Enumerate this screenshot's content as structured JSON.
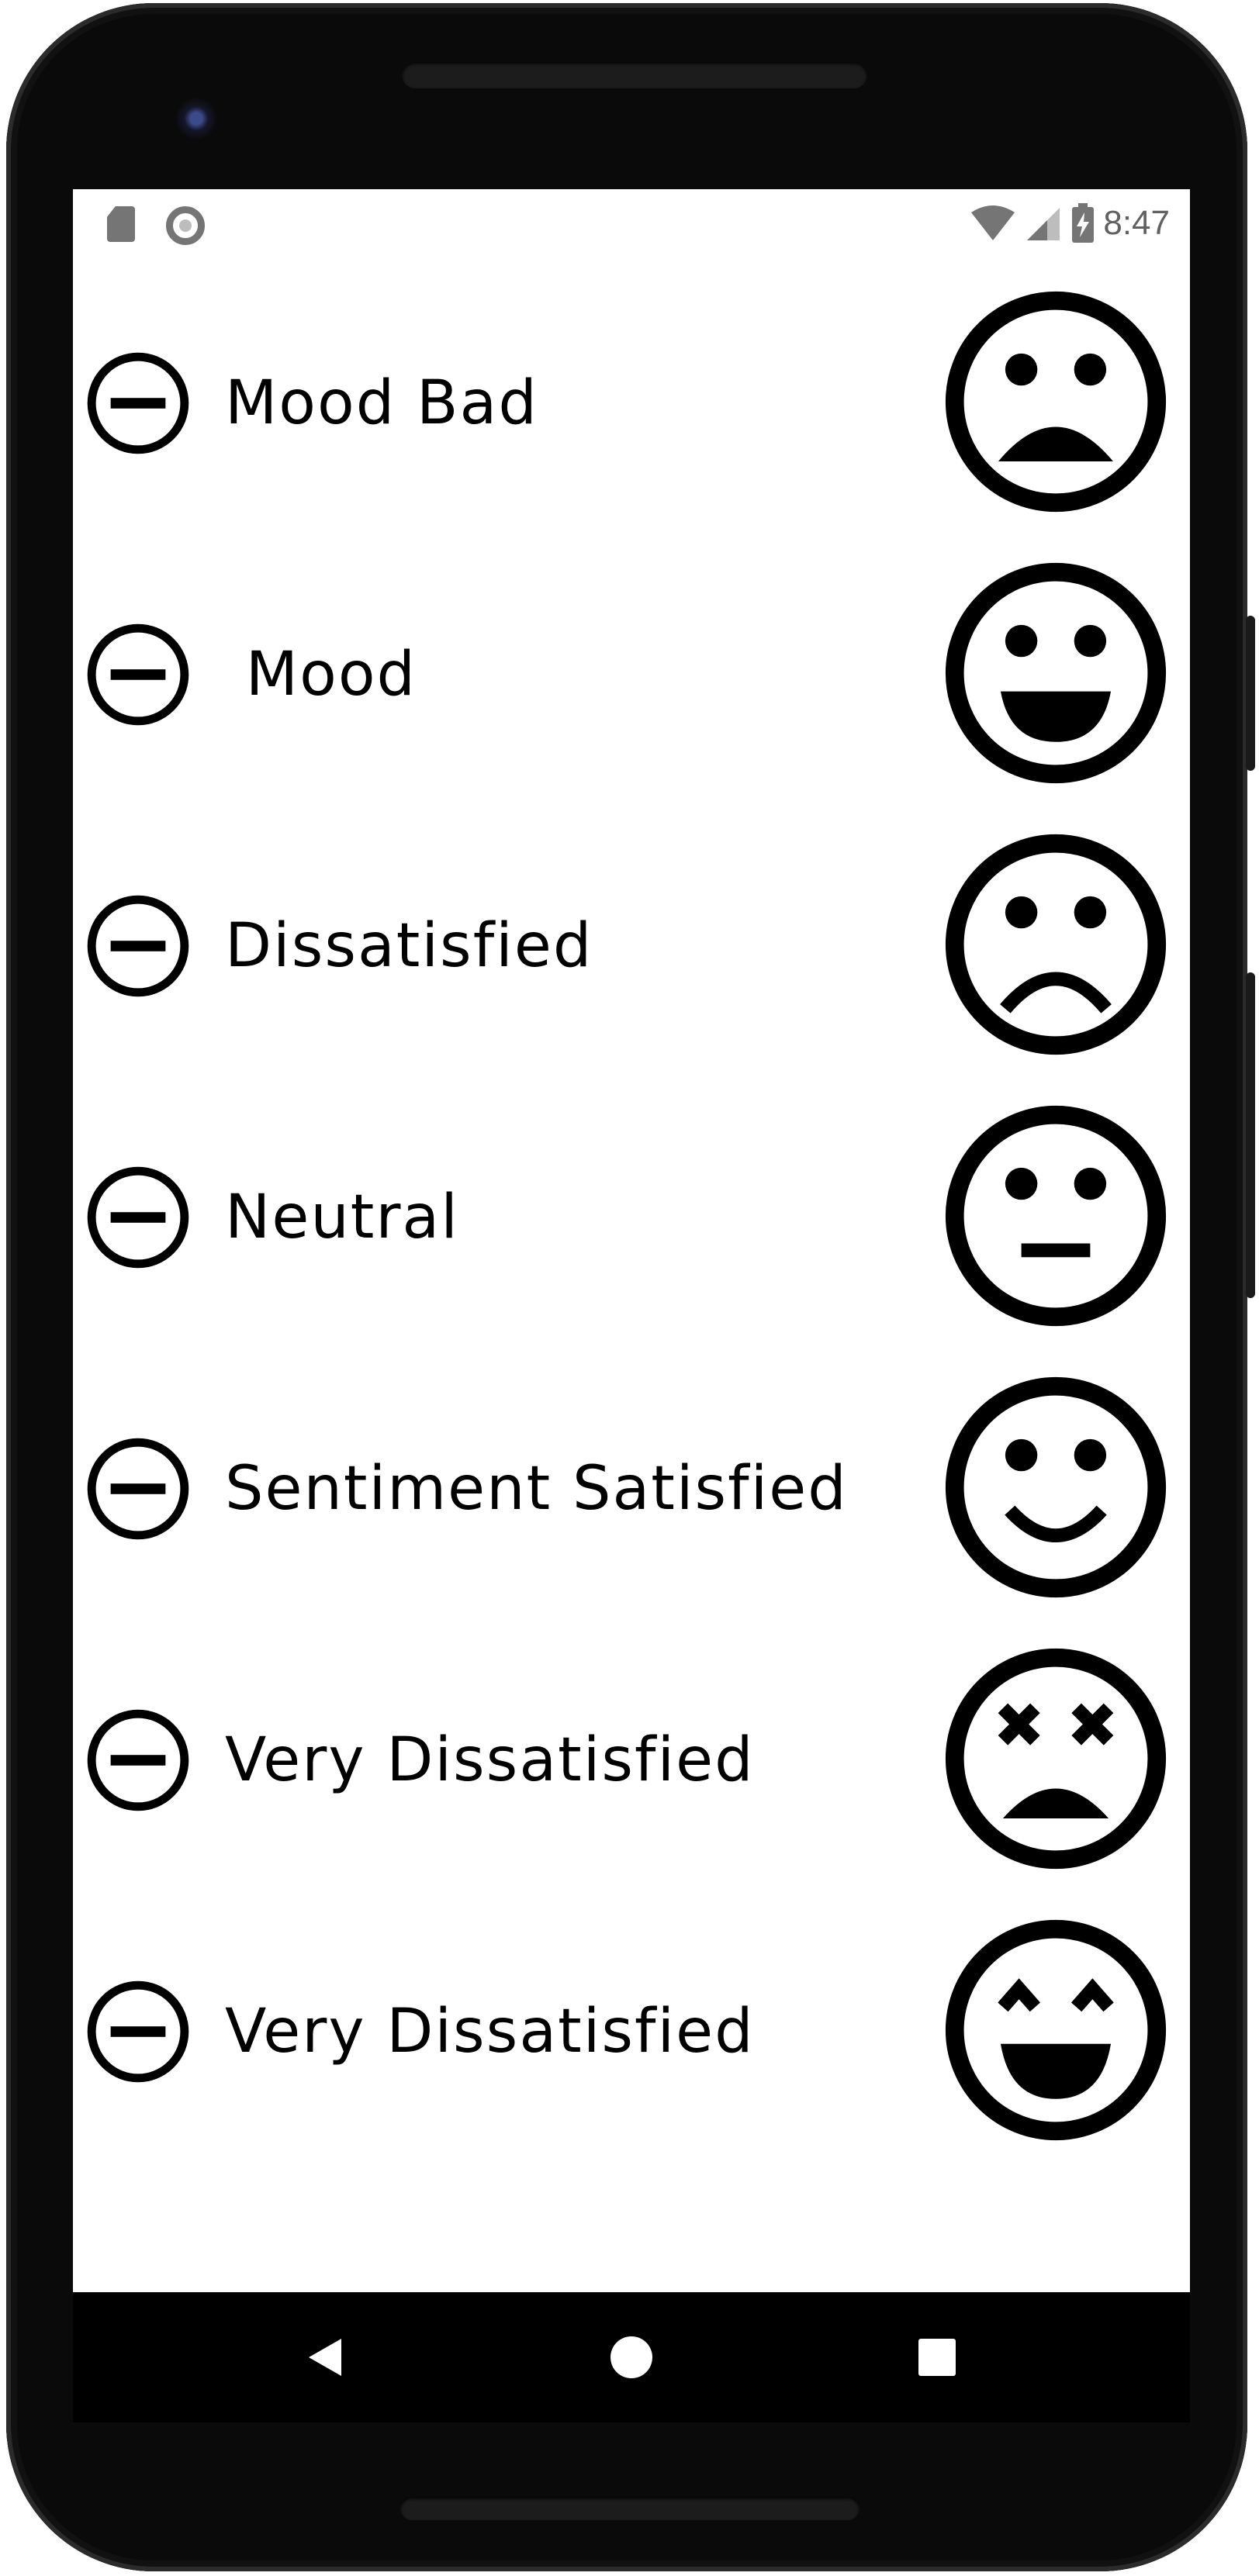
{
  "status_bar": {
    "time": "8:47",
    "left_icons": [
      "sd-card-icon",
      "sync-circle-icon"
    ],
    "right_icons": [
      "wifi-icon",
      "cell-signal-icon",
      "battery-charging-icon"
    ]
  },
  "list": {
    "items": [
      {
        "label": "Mood Bad",
        "left_icon": "remove-circle-icon",
        "face_icon": "mood-bad-icon"
      },
      {
        "label": " Mood",
        "left_icon": "remove-circle-icon",
        "face_icon": "mood-icon"
      },
      {
        "label": "Dissatisfied",
        "left_icon": "remove-circle-icon",
        "face_icon": "sentiment-dissatisfied-icon"
      },
      {
        "label": "Neutral",
        "left_icon": "remove-circle-icon",
        "face_icon": "sentiment-neutral-icon"
      },
      {
        "label": "Sentiment Satisfied",
        "left_icon": "remove-circle-icon",
        "face_icon": "sentiment-satisfied-icon"
      },
      {
        "label": "Very Dissatisfied",
        "left_icon": "remove-circle-icon",
        "face_icon": "sentiment-very-dissatisfied-icon"
      },
      {
        "label": "Very Dissatisfied",
        "left_icon": "remove-circle-icon",
        "face_icon": "sentiment-very-satisfied-icon"
      }
    ]
  },
  "nav_bar": {
    "icons": [
      "back-icon",
      "home-icon",
      "recents-icon"
    ]
  },
  "colors": {
    "device_body": "#0a0a0a",
    "screen_background": "#ffffff",
    "icon_color": "#000000",
    "status_icons": "#757575",
    "navbar_background": "#000000",
    "navbar_icons": "#ffffff"
  }
}
